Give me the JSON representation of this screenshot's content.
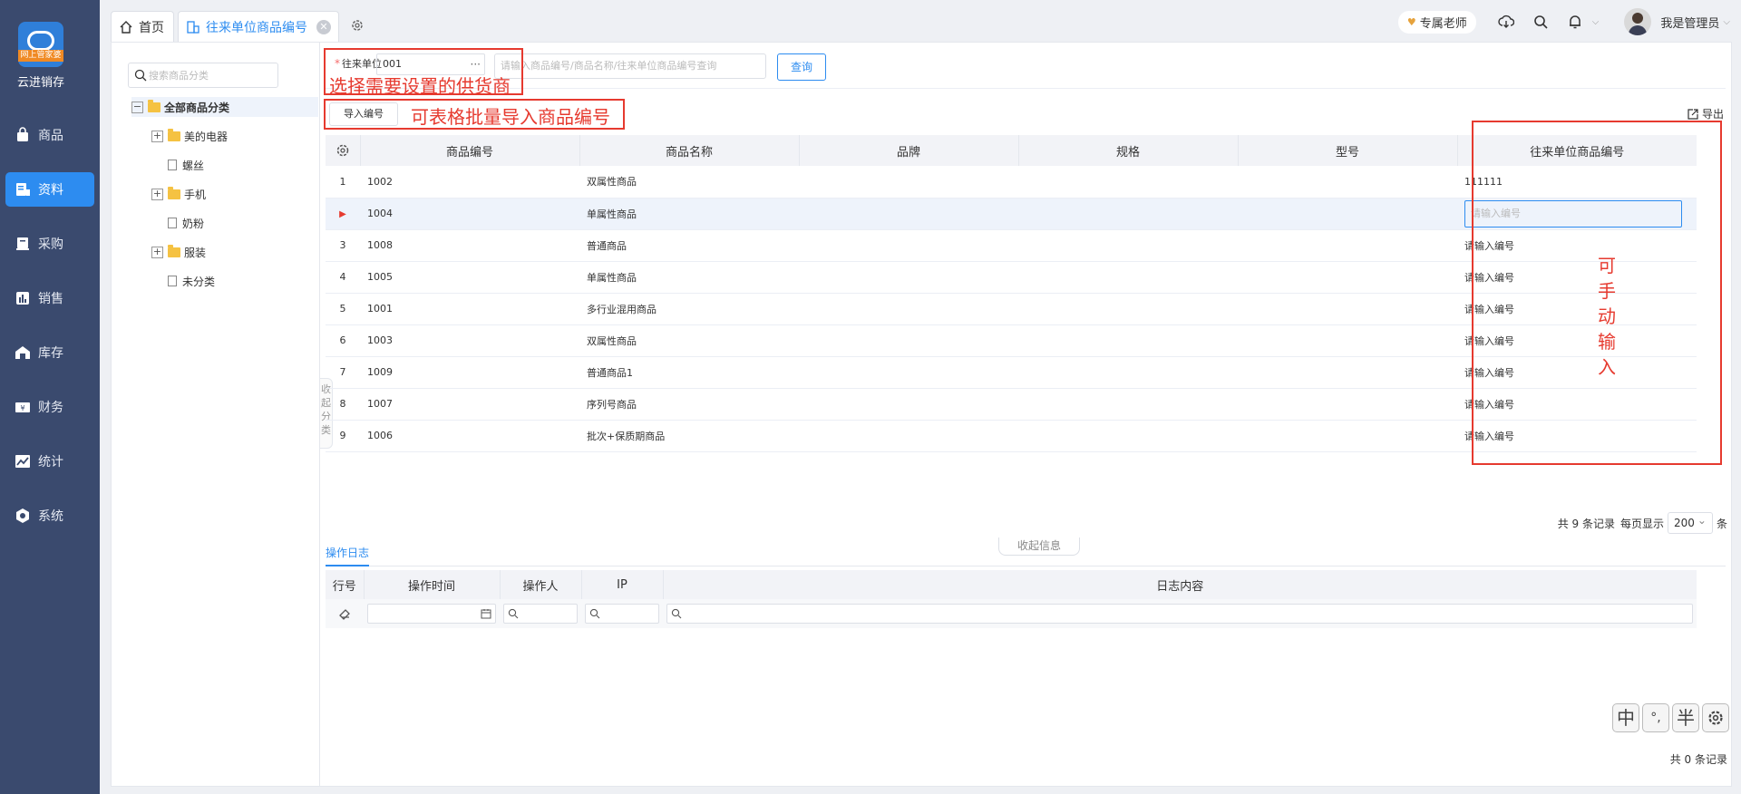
{
  "brand": {
    "logo_band": "网上管家婆",
    "name": "云进销存"
  },
  "nav": [
    {
      "label": "商品",
      "icon": "bag-icon",
      "active": false
    },
    {
      "label": "资料",
      "icon": "document-icon",
      "active": true
    },
    {
      "label": "采购",
      "icon": "cart-icon",
      "active": false
    },
    {
      "label": "销售",
      "icon": "bar-chart-icon",
      "active": false
    },
    {
      "label": "库存",
      "icon": "warehouse-icon",
      "active": false
    },
    {
      "label": "财务",
      "icon": "money-icon",
      "active": false
    },
    {
      "label": "统计",
      "icon": "trend-icon",
      "active": false
    },
    {
      "label": "系统",
      "icon": "hexagon-gear-icon",
      "active": false
    }
  ],
  "tabs": {
    "home": "首页",
    "current": "往来单位商品编号"
  },
  "topbar": {
    "vip": "专属老师",
    "user_name": "我是管理员"
  },
  "tree": {
    "search_placeholder": "搜索商品分类",
    "nodes": [
      {
        "label": "全部商品分类"
      },
      {
        "label": "美的电器"
      },
      {
        "label": "螺丝"
      },
      {
        "label": "手机"
      },
      {
        "label": "奶粉"
      },
      {
        "label": "服装"
      },
      {
        "label": "未分类"
      }
    ],
    "collapse_label": "收起分类"
  },
  "filter": {
    "supplier_label": "往来单位",
    "supplier_value": "001",
    "search_placeholder": "请输入商品编号/商品名称/往来单位商品编号查询",
    "query_button": "查询",
    "import_button": "导入编号",
    "export_label": "导出"
  },
  "annotations": {
    "supplier_note": "选择需要设置的供货商",
    "import_note": "可表格批量导入商品编号",
    "manual_note": [
      "可",
      "手",
      "动",
      "输",
      "入"
    ]
  },
  "grid": {
    "columns": [
      "商品编号",
      "商品名称",
      "品牌",
      "规格",
      "型号",
      "往来单位商品编号"
    ],
    "placeholder": "请输入编号",
    "rows": [
      {
        "no": "1",
        "code": "1002",
        "name": "双属性商品",
        "partner_code": "111111"
      },
      {
        "no": "",
        "code": "1004",
        "name": "单属性商品",
        "partner_code": ""
      },
      {
        "no": "3",
        "code": "1008",
        "name": "普通商品",
        "partner_code": ""
      },
      {
        "no": "4",
        "code": "1005",
        "name": "单属性商品",
        "partner_code": ""
      },
      {
        "no": "5",
        "code": "1001",
        "name": "多行业混用商品",
        "partner_code": ""
      },
      {
        "no": "6",
        "code": "1003",
        "name": "双属性商品",
        "partner_code": ""
      },
      {
        "no": "7",
        "code": "1009",
        "name": "普通商品1",
        "partner_code": ""
      },
      {
        "no": "8",
        "code": "1007",
        "name": "序列号商品",
        "partner_code": ""
      },
      {
        "no": "9",
        "code": "1006",
        "name": "批次+保质期商品",
        "partner_code": ""
      }
    ]
  },
  "pager": {
    "total": "共 9 条记录",
    "per_page_label": "每页显示",
    "per_page": "200",
    "suffix": "条"
  },
  "log": {
    "tab": "操作日志",
    "fold_label": "收起信息",
    "columns": [
      "行号",
      "操作时间",
      "操作人",
      "IP",
      "日志内容"
    ],
    "total": "共 0 条记录"
  },
  "ime": [
    "中",
    "°,",
    "半"
  ]
}
